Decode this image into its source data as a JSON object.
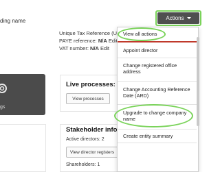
{
  "background": {
    "company_name_fragment": "ding name",
    "gray_card_label": "gs",
    "utr_line": "Unique Tax Reference (UTR",
    "paye_label": "PAYE reference: ",
    "paye_value": "N/A",
    "paye_edit": "Edit",
    "vat_label": "VAT number: ",
    "vat_value": "N/A",
    "vat_edit": "Edit",
    "live_processes_title": "Live processes: 0",
    "view_processes_label": "View processes",
    "stakeholder_title": "Stakeholder inform",
    "active_directors": "Active directors: 2",
    "view_directors_label": "View director registers",
    "shareholders": "Shareholders: 1"
  },
  "actions_button": {
    "label": "Actions"
  },
  "dropdown": {
    "items": [
      {
        "label": "View all actions"
      },
      {
        "label": "Appoint director"
      },
      {
        "label": "Change registered office address"
      },
      {
        "label": "Change Accounting Reference Date (ARD)"
      },
      {
        "label": "Upgrade to change company name"
      },
      {
        "label": "Create entity summary"
      }
    ]
  },
  "colors": {
    "highlight": "#7ad35a",
    "button_bg": "#4f4f4f",
    "separator_red": "#c0392b"
  },
  "icons": {
    "actions_caret": "caret-down-icon",
    "gray_card_icon": "gear-icon"
  }
}
